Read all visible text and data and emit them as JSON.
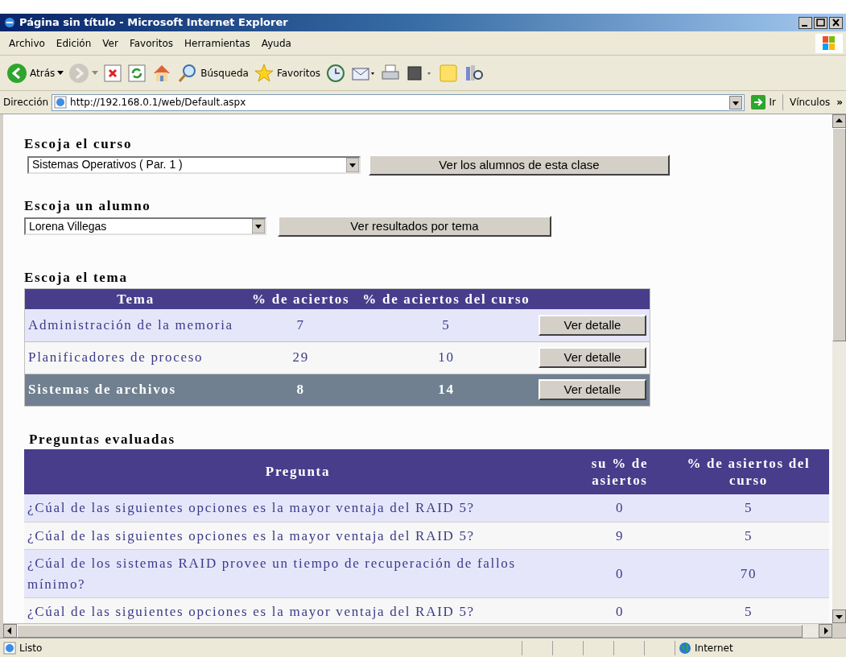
{
  "window": {
    "title": "Página sin título - Microsoft Internet Explorer"
  },
  "menu": [
    "Archivo",
    "Edición",
    "Ver",
    "Favoritos",
    "Herramientas",
    "Ayuda"
  ],
  "toolbar": [
    {
      "kind": "back",
      "label": "Atrás",
      "disabled": false
    },
    {
      "kind": "forward",
      "disabled": true
    },
    {
      "kind": "stop",
      "disabled": false
    },
    {
      "kind": "refresh",
      "disabled": false
    },
    {
      "kind": "home",
      "disabled": false
    },
    {
      "kind": "search",
      "label": "Búsqueda",
      "disabled": false
    },
    {
      "kind": "favorites",
      "label": "Favoritos",
      "disabled": false
    },
    {
      "kind": "history",
      "disabled": false
    },
    {
      "kind": "mail",
      "disabled": false
    },
    {
      "kind": "print",
      "disabled": false
    },
    {
      "kind": "edit",
      "disabled": false
    },
    {
      "kind": "note",
      "disabled": false
    },
    {
      "kind": "research",
      "disabled": false
    }
  ],
  "address": {
    "label": "Dirección",
    "value": "http://192.168.0.1/web/Default.aspx",
    "go": "Ir",
    "links": "Vínculos",
    "more": "»"
  },
  "course": {
    "label": "Escoja el curso",
    "value": "Sistemas Operativos ( Par. 1 )",
    "button": "Ver los alumnos de esta clase"
  },
  "student": {
    "label": "Escoja un alumno",
    "value": "Lorena Villegas",
    "button": "Ver resultados por tema"
  },
  "topics": {
    "label": "Escoja el tema",
    "columns": [
      "Tema",
      "% de aciertos",
      "% de aciertos del curso"
    ],
    "rows": [
      {
        "topic": "Administración de la memoria",
        "own": "7",
        "course": "5",
        "button": "Ver detalle",
        "selected": false
      },
      {
        "topic": "Planificadores de proceso",
        "own": "29",
        "course": "10",
        "button": "Ver detalle",
        "selected": false
      },
      {
        "topic": "Sistemas de archivos",
        "own": "8",
        "course": "14",
        "button": "Ver detalle",
        "selected": true
      }
    ]
  },
  "questions": {
    "label": "Preguntas evaluadas",
    "columns": [
      "Pregunta",
      "su % de asiertos",
      "% de asiertos del curso"
    ],
    "rows": [
      {
        "question": "¿Cúal de las siguientes opciones es la mayor ventaja del RAID 5?",
        "own": "0",
        "course": "5"
      },
      {
        "question": "¿Cúal de las siguientes opciones es la mayor ventaja del RAID 5?",
        "own": "9",
        "course": "5"
      },
      {
        "question": "¿Cúal de los sistemas RAID provee un tiempo de recuperación de fallos mínimo?",
        "own": "0",
        "course": "70"
      },
      {
        "question": "¿Cúal de las siguientes opciones es la mayor ventaja del RAID 5?",
        "own": "0",
        "course": "5"
      }
    ]
  },
  "status_bar": {
    "text": "Listo",
    "zone": "Internet"
  }
}
